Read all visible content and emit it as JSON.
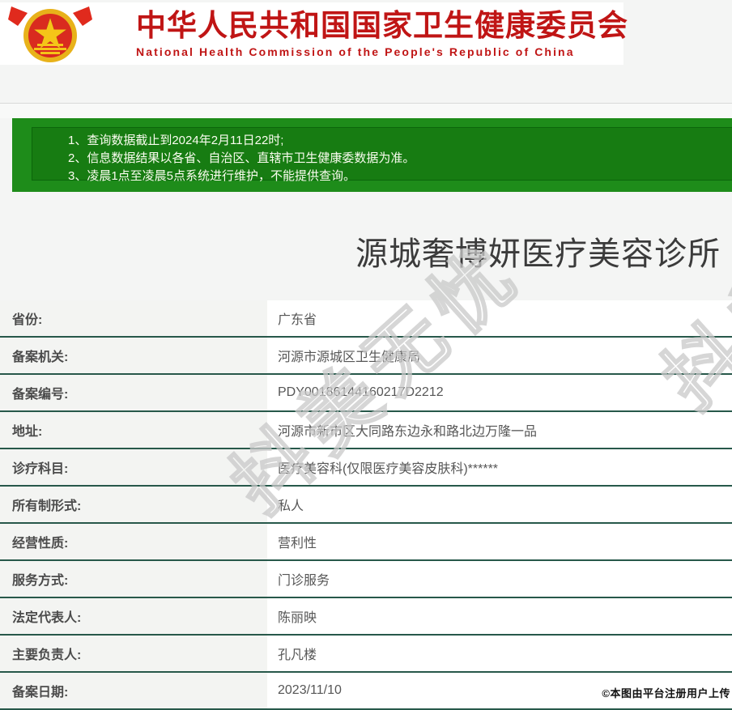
{
  "header": {
    "title_cn": "中华人民共和国国家卫生健康委员会",
    "title_en": "National Health Commission of the People's Republic of China",
    "emblem_icon": "national-emblem-icon"
  },
  "notice": {
    "lines": [
      "1、查询数据截止到2024年2月11日22时;",
      "2、信息数据结果以各省、自治区、直辖市卫生健康委数据为准。",
      "3、凌晨1点至凌晨5点系统进行维护，不能提供查询。"
    ]
  },
  "clinic": {
    "name": "源城奢博妍医疗美容诊所"
  },
  "table": {
    "rows": [
      {
        "label": "省份:",
        "value": "广东省"
      },
      {
        "label": "备案机关:",
        "value": "河源市源城区卫生健康局"
      },
      {
        "label": "备案编号:",
        "value": "PDY00186144160217D2212"
      },
      {
        "label": "地址:",
        "value": "河源市新市区大同路东边永和路北边万隆一品"
      },
      {
        "label": "诊疗科目:",
        "value": "医疗美容科(仅限医疗美容皮肤科)******"
      },
      {
        "label": "所有制形式:",
        "value": "私人"
      },
      {
        "label": "经营性质:",
        "value": "营利性"
      },
      {
        "label": "服务方式:",
        "value": "门诊服务"
      },
      {
        "label": "法定代表人:",
        "value": "陈丽映"
      },
      {
        "label": "主要负责人:",
        "value": "孔凡楼"
      },
      {
        "label": "备案日期:",
        "value": "2023/11/10"
      }
    ]
  },
  "watermark": {
    "text": "抖美无忧"
  },
  "footer": {
    "credit": "©本图由平台注册用户上传"
  },
  "colors": {
    "header_red": "#c01515",
    "notice_green": "#1e8c1a",
    "notice_inner_green": "#177c12",
    "divider_green": "#27584a",
    "page_bg": "#f4f5f4"
  }
}
